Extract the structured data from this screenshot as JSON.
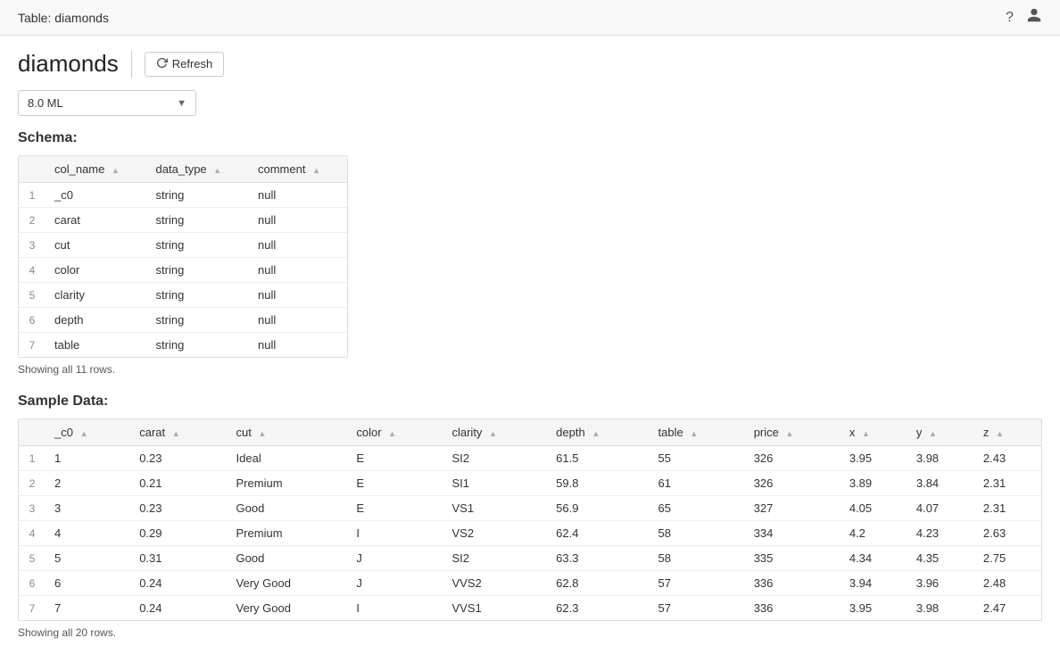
{
  "header": {
    "title": "Table: diamonds",
    "help_icon": "?",
    "user_icon": "👤"
  },
  "page": {
    "title": "diamonds",
    "refresh_label": "Refresh",
    "version_select": {
      "value": "8.0 ML",
      "options": [
        "8.0 ML"
      ]
    }
  },
  "schema": {
    "heading": "Schema:",
    "showing_rows": "Showing all 11 rows.",
    "columns": [
      {
        "key": "row_num",
        "label": ""
      },
      {
        "key": "col_name",
        "label": "col_name"
      },
      {
        "key": "data_type",
        "label": "data_type"
      },
      {
        "key": "comment",
        "label": "comment"
      }
    ],
    "rows": [
      {
        "row_num": "1",
        "col_name": "_c0",
        "data_type": "string",
        "comment": "null"
      },
      {
        "row_num": "2",
        "col_name": "carat",
        "data_type": "string",
        "comment": "null"
      },
      {
        "row_num": "3",
        "col_name": "cut",
        "data_type": "string",
        "comment": "null"
      },
      {
        "row_num": "4",
        "col_name": "color",
        "data_type": "string",
        "comment": "null"
      },
      {
        "row_num": "5",
        "col_name": "clarity",
        "data_type": "string",
        "comment": "null"
      },
      {
        "row_num": "6",
        "col_name": "depth",
        "data_type": "string",
        "comment": "null"
      },
      {
        "row_num": "7",
        "col_name": "table",
        "data_type": "string",
        "comment": "null"
      }
    ]
  },
  "sample_data": {
    "heading": "Sample Data:",
    "showing_rows": "Showing all 20 rows.",
    "columns": [
      {
        "key": "row_num",
        "label": ""
      },
      {
        "key": "_c0",
        "label": "_c0"
      },
      {
        "key": "carat",
        "label": "carat"
      },
      {
        "key": "cut",
        "label": "cut"
      },
      {
        "key": "color",
        "label": "color"
      },
      {
        "key": "clarity",
        "label": "clarity"
      },
      {
        "key": "depth",
        "label": "depth"
      },
      {
        "key": "table",
        "label": "table"
      },
      {
        "key": "price",
        "label": "price"
      },
      {
        "key": "x",
        "label": "x"
      },
      {
        "key": "y",
        "label": "y"
      },
      {
        "key": "z",
        "label": "z"
      }
    ],
    "rows": [
      {
        "row_num": "1",
        "_c0": "1",
        "carat": "0.23",
        "cut": "Ideal",
        "color": "E",
        "clarity": "SI2",
        "depth": "61.5",
        "table": "55",
        "price": "326",
        "x": "3.95",
        "y": "3.98",
        "z": "2.43"
      },
      {
        "row_num": "2",
        "_c0": "2",
        "carat": "0.21",
        "cut": "Premium",
        "color": "E",
        "clarity": "SI1",
        "depth": "59.8",
        "table": "61",
        "price": "326",
        "x": "3.89",
        "y": "3.84",
        "z": "2.31"
      },
      {
        "row_num": "3",
        "_c0": "3",
        "carat": "0.23",
        "cut": "Good",
        "color": "E",
        "clarity": "VS1",
        "depth": "56.9",
        "table": "65",
        "price": "327",
        "x": "4.05",
        "y": "4.07",
        "z": "2.31"
      },
      {
        "row_num": "4",
        "_c0": "4",
        "carat": "0.29",
        "cut": "Premium",
        "color": "I",
        "clarity": "VS2",
        "depth": "62.4",
        "table": "58",
        "price": "334",
        "x": "4.2",
        "y": "4.23",
        "z": "2.63"
      },
      {
        "row_num": "5",
        "_c0": "5",
        "carat": "0.31",
        "cut": "Good",
        "color": "J",
        "clarity": "SI2",
        "depth": "63.3",
        "table": "58",
        "price": "335",
        "x": "4.34",
        "y": "4.35",
        "z": "2.75"
      },
      {
        "row_num": "6",
        "_c0": "6",
        "carat": "0.24",
        "cut": "Very Good",
        "color": "J",
        "clarity": "VVS2",
        "depth": "62.8",
        "table": "57",
        "price": "336",
        "x": "3.94",
        "y": "3.96",
        "z": "2.48"
      },
      {
        "row_num": "7",
        "_c0": "7",
        "carat": "0.24",
        "cut": "Very Good",
        "color": "I",
        "clarity": "VVS1",
        "depth": "62.3",
        "table": "57",
        "price": "336",
        "x": "3.95",
        "y": "3.98",
        "z": "2.47"
      }
    ]
  },
  "sort_icon": "▲"
}
